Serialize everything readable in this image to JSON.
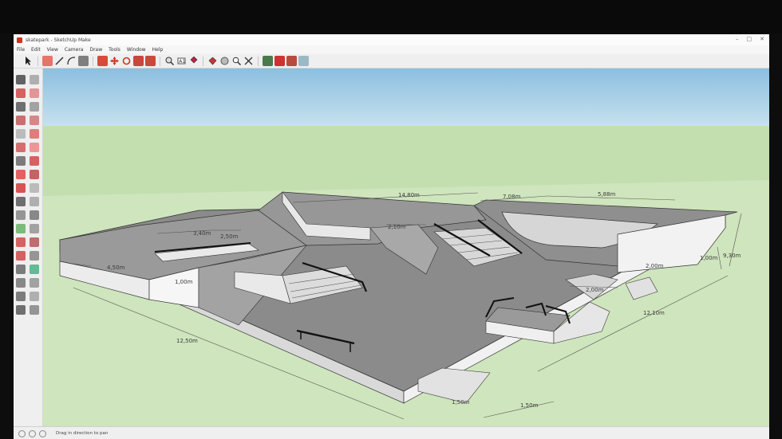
{
  "window": {
    "title": "skatepark - SketchUp Make"
  },
  "menu": [
    "File",
    "Edit",
    "View",
    "Camera",
    "Draw",
    "Tools",
    "Window",
    "Help"
  ],
  "toolbar_icons": [
    "select-icon",
    "eraser-icon",
    "line-icon",
    "arc-icon",
    "rectangle-icon",
    "push-pull-icon",
    "move-icon",
    "rotate-icon",
    "scale-icon",
    "offset-icon",
    "tape-measure-icon",
    "text-icon",
    "paint-bucket-icon",
    "orbit-icon",
    "pan-icon",
    "zoom-icon",
    "zoom-extents-icon",
    "warehouse-icon",
    "extension-icon",
    "layout-icon"
  ],
  "sidebar_icons": [
    "select-icon",
    "component-icon",
    "paint-bucket-icon",
    "eraser-icon",
    "line-icon",
    "freehand-icon",
    "rectangle-icon",
    "rotated-rectangle-icon",
    "circle-icon",
    "polygon-icon",
    "arc-icon",
    "pie-icon",
    "arc3-icon",
    "arc2-icon",
    "move-icon",
    "push-pull-icon",
    "rotate-icon",
    "follow-me-icon",
    "scale-icon",
    "offset-icon",
    "tape-measure-icon",
    "dimension-icon",
    "protractor-icon",
    "text-icon",
    "axes-icon",
    "3d-text-icon",
    "orbit-icon",
    "pan-icon",
    "zoom-icon",
    "zoom-window-icon",
    "zoom-extents-icon",
    "previous-icon",
    "position-camera-icon",
    "look-around-icon",
    "walk-icon",
    "section-icon"
  ],
  "dimensions": {
    "d1": "14,80m",
    "d2": "7,08m",
    "d3": "5,88m",
    "d4": "3,40m",
    "d5": "2,50m",
    "d6": "2,10m",
    "d7": "9,30m",
    "d8": "1,00m",
    "d9": "12,50m",
    "d10": "12,10m",
    "d11": "2,00m",
    "d12": "1,50m",
    "d13": "1,50m",
    "d14": "1,00m",
    "d15": "4,50m",
    "d16": "2,00m"
  },
  "status": {
    "text": "Drag in direction to pan"
  },
  "colors": {
    "sky": "#9fcbe4",
    "ground": "#cbe2b8",
    "surface": "#8a8a8a",
    "wall": "#e6e6e6",
    "accent": "#d2321f"
  }
}
